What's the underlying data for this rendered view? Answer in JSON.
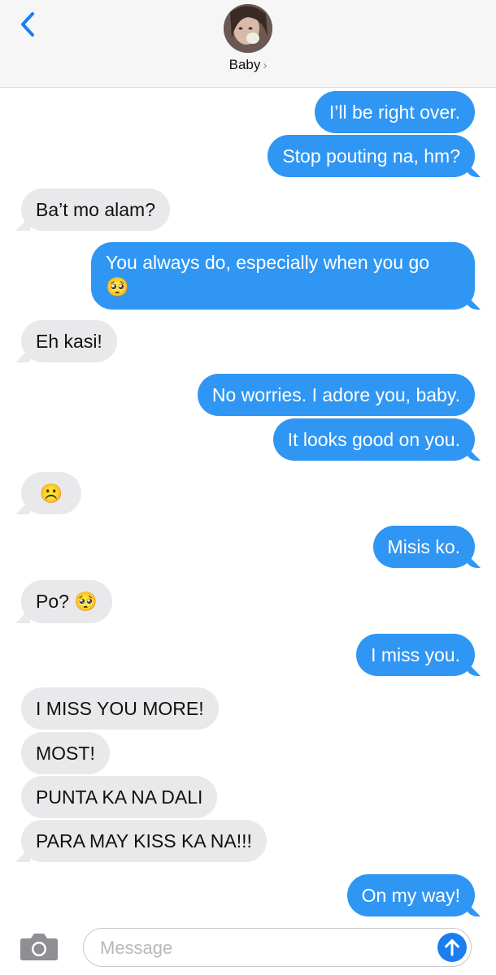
{
  "header": {
    "contact_name": "Baby",
    "chevron": "›",
    "avatar_icon": "contact-photo"
  },
  "messages": [
    {
      "direction": "out",
      "text": "I’ll be right over."
    },
    {
      "direction": "out",
      "text": "Stop pouting na, hm?"
    },
    {
      "direction": "in",
      "text": "Ba’t mo alam?"
    },
    {
      "direction": "out",
      "text": "You always do, especially when you go",
      "emoji": "🥺"
    },
    {
      "direction": "in",
      "text": "Eh kasi!"
    },
    {
      "direction": "out",
      "text": "No worries. I adore you, baby."
    },
    {
      "direction": "out",
      "text": "It looks good on you."
    },
    {
      "direction": "in",
      "text": "",
      "emoji": "☹️"
    },
    {
      "direction": "out",
      "text": "Misis ko."
    },
    {
      "direction": "in",
      "text": "Po?",
      "emoji": "🥺"
    },
    {
      "direction": "out",
      "text": "I miss you."
    },
    {
      "direction": "in",
      "text": "I MISS YOU MORE!"
    },
    {
      "direction": "in",
      "text": "MOST!"
    },
    {
      "direction": "in",
      "text": "PUNTA KA NA DALI"
    },
    {
      "direction": "in",
      "text": "PARA MAY KISS KA NA!!!"
    },
    {
      "direction": "out",
      "text": "On my way!"
    }
  ],
  "composer": {
    "placeholder": "Message",
    "camera_icon": "camera-icon",
    "send_icon": "arrow-up-icon"
  },
  "colors": {
    "outgoing_bubble": "#2f96f3",
    "incoming_bubble": "#e9e9eb",
    "accent": "#1a7ef0"
  }
}
